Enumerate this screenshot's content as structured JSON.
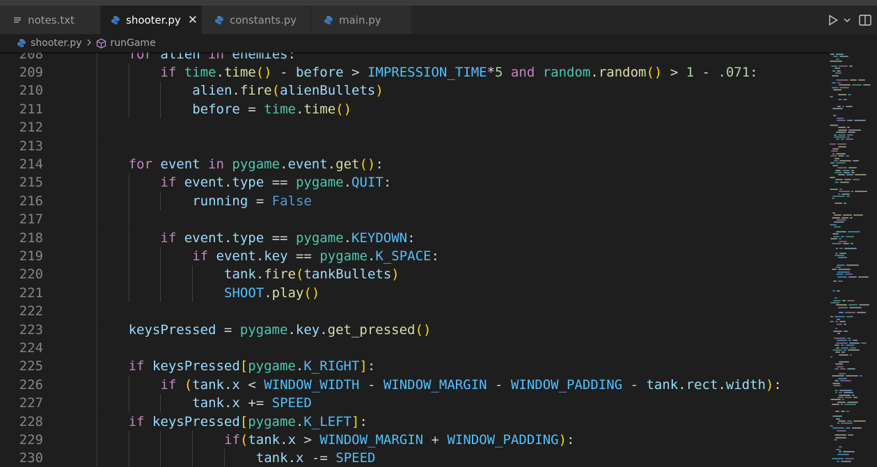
{
  "tabs": [
    {
      "label": "notes.txt",
      "icon": "list-icon",
      "active": false
    },
    {
      "label": "shooter.py",
      "icon": "python-icon",
      "active": true
    },
    {
      "label": "constants.py",
      "icon": "python-icon",
      "active": false
    },
    {
      "label": "main.py",
      "icon": "python-icon",
      "active": false
    }
  ],
  "actions": {
    "run": "run-icon",
    "split": "split-editor-icon"
  },
  "breadcrumb": {
    "file": "shooter.py",
    "symbol": "runGame",
    "file_icon": "python-icon",
    "symbol_icon": "cube-icon"
  },
  "editor": {
    "partial_line": "for alien in enemies:",
    "lines": [
      {
        "n": "208",
        "indent": 2,
        "text": "for alien in enemies:"
      },
      {
        "n": "209",
        "indent": 3,
        "text": "if time.time() - before > IMPRESSION_TIME*5 and random.random() > 1 - .071:"
      },
      {
        "n": "210",
        "indent": 4,
        "text": "alien.fire(alienBullets)"
      },
      {
        "n": "211",
        "indent": 4,
        "text": "before = time.time()"
      },
      {
        "n": "212",
        "indent": 0,
        "text": ""
      },
      {
        "n": "213",
        "indent": 0,
        "text": ""
      },
      {
        "n": "214",
        "indent": 2,
        "text": "for event in pygame.event.get():"
      },
      {
        "n": "215",
        "indent": 3,
        "text": "if event.type == pygame.QUIT:"
      },
      {
        "n": "216",
        "indent": 4,
        "text": "running = False"
      },
      {
        "n": "217",
        "indent": 0,
        "text": ""
      },
      {
        "n": "218",
        "indent": 3,
        "text": "if event.type == pygame.KEYDOWN:"
      },
      {
        "n": "219",
        "indent": 4,
        "text": "if event.key == pygame.K_SPACE:"
      },
      {
        "n": "220",
        "indent": 5,
        "text": "tank.fire(tankBullets)"
      },
      {
        "n": "221",
        "indent": 5,
        "text": "SHOOT.play()"
      },
      {
        "n": "222",
        "indent": 0,
        "text": ""
      },
      {
        "n": "223",
        "indent": 2,
        "text": "keysPressed = pygame.key.get_pressed()"
      },
      {
        "n": "224",
        "indent": 0,
        "text": ""
      },
      {
        "n": "225",
        "indent": 2,
        "text": "if keysPressed[pygame.K_RIGHT]:"
      },
      {
        "n": "226",
        "indent": 3,
        "text": "if (tank.x < WINDOW_WIDTH - WINDOW_MARGIN - WINDOW_PADDING - tank.rect.width):"
      },
      {
        "n": "227",
        "indent": 4,
        "text": "tank.x += SPEED"
      },
      {
        "n": "228",
        "indent": 2,
        "text": "if keysPressed[pygame.K_LEFT]:"
      },
      {
        "n": "229",
        "indent": 5,
        "text": "if(tank.x > WINDOW_MARGIN + WINDOW_PADDING):"
      },
      {
        "n": "230",
        "indent": 6,
        "text": "tank.x -= SPEED"
      }
    ]
  },
  "colors": {
    "keyword": "#c586c0",
    "variable": "#9cdcfe",
    "function": "#dcdcaa",
    "class": "#4ec9b0",
    "constant": "#4fc1ff",
    "number": "#b5cea8",
    "boolean": "#569cd6",
    "bracket1": "#ffd700",
    "bracket2": "#da70d6",
    "bracket3": "#179fff",
    "python_icon": "#3d7fc4"
  }
}
